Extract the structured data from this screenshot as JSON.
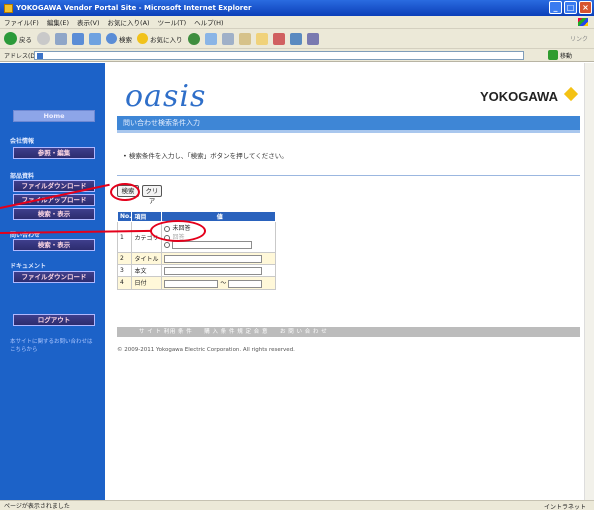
{
  "window": {
    "title": "YOKOGAWA Vendor Portal Site - Microsoft Internet Explorer",
    "minimize": "_",
    "maximize": "□",
    "close": "×"
  },
  "menu": [
    "ファイル(F)",
    "編集(E)",
    "表示(V)",
    "お気に入り(A)",
    "ツール(T)",
    "ヘルプ(H)"
  ],
  "toolbar": {
    "back": "戻る",
    "search": "検索",
    "favorites": "お気に入り",
    "links": "リンク"
  },
  "address": {
    "label": "アドレス(D)",
    "go": "移動"
  },
  "sidebar": {
    "home": "Home",
    "section_company": "会社情報",
    "btn_view_edit": "参照・編集",
    "section_parts": "部品資料",
    "btn_download": "ファイルダウンロード",
    "btn_upload": "ファイルアップロード",
    "btn_search_view": "検索・表示",
    "section_inquiry": "問い合わせ",
    "btn_inquiry_view": "検索・表示",
    "section_docs": "ドキュメント",
    "btn_doc_download": "ファイルダウンロード",
    "logout": "ログアウト",
    "note": "本サイトに関するお問い合わせはこちらから"
  },
  "header": {
    "logo": "oasis",
    "brand": "YOKOGAWA"
  },
  "page": {
    "title": "問い合わせ検索条件入力",
    "instruction": "• 検索条件を入力し、「検索」ボタンを押してください。",
    "search_button": "検索",
    "clear_button": "クリア"
  },
  "form": {
    "col_no": "No.",
    "col_item": "項目",
    "col_value": "値",
    "rows": [
      {
        "no": "1",
        "label": "カテゴリ",
        "radio1": "未回答",
        "radio2": "回答"
      },
      {
        "no": "2",
        "label": "タイトル"
      },
      {
        "no": "3",
        "label": "本文"
      },
      {
        "no": "4",
        "label": "日付",
        "sep": "〜"
      }
    ]
  },
  "footer": {
    "links": "サ イ ト 利用 条 件　　購 入 条 件 規 定 合 意　　お 問 い 合 わ せ",
    "copyright": "© 2009-2011 Yokogawa Electric Corporation. All rights reserved."
  },
  "status": {
    "left": "ページが表示されました",
    "zone": "イントラネット"
  },
  "colors": {
    "sidebar": "#1c62c8",
    "header_bar": "#3e86d6",
    "annotation": "#e4001b"
  }
}
